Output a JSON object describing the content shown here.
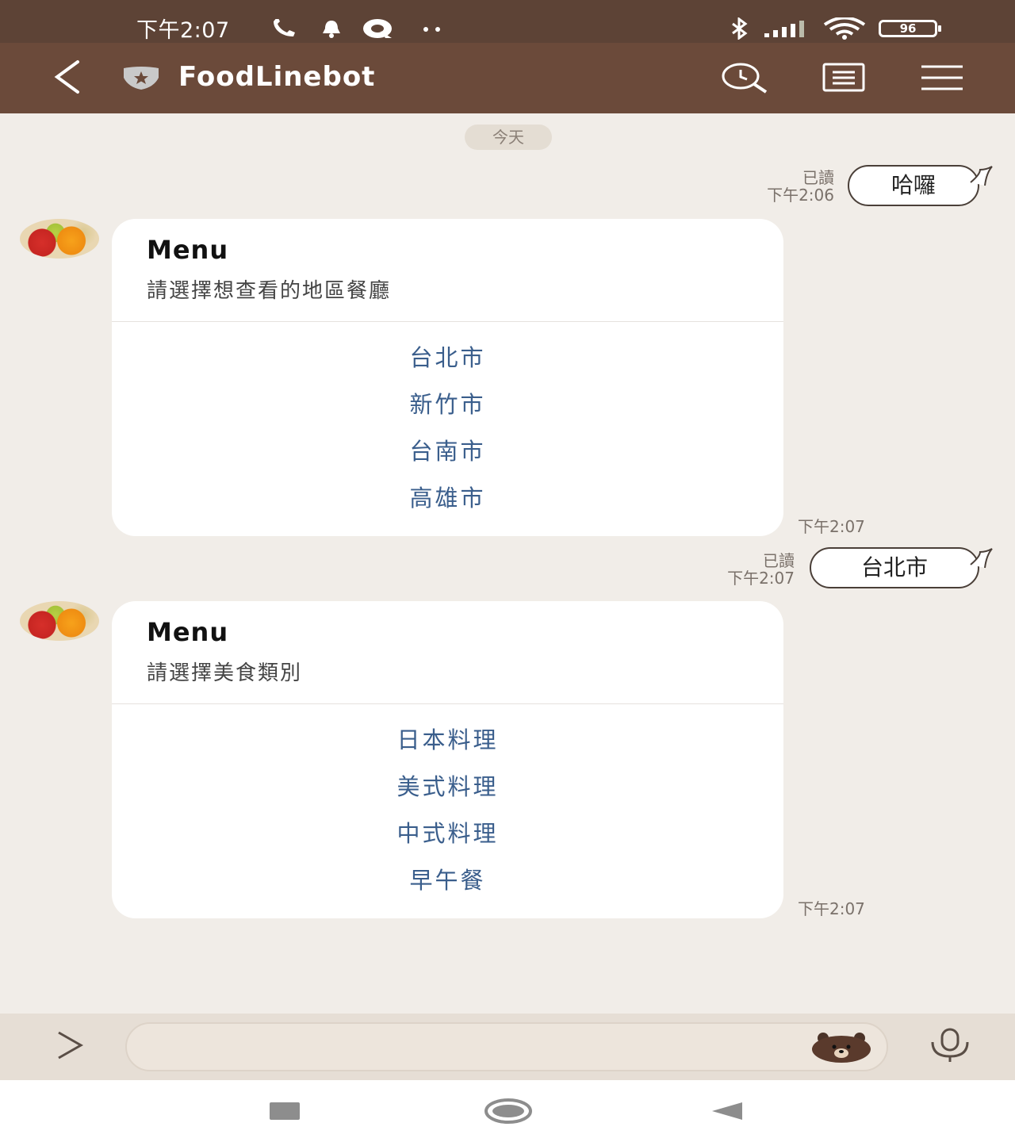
{
  "status_bar": {
    "time": "下午2:07",
    "icons": [
      "phone-icon",
      "bell-icon",
      "q-app-icon",
      "more-dots-icon",
      "bluetooth-icon",
      "signal-icon",
      "wifi-icon",
      "battery-icon"
    ],
    "battery": "96"
  },
  "header": {
    "title": "FoodLinebot",
    "icons": [
      "back-icon",
      "shield-icon",
      "search-history-icon",
      "notes-icon",
      "menu-icon"
    ]
  },
  "date_divider": "今天",
  "messages": [
    {
      "type": "sent",
      "text": "哈囉",
      "read": "已讀",
      "time": "下午2:06"
    },
    {
      "type": "received_card",
      "title": "Menu",
      "subtitle": "請選擇想查看的地區餐廳",
      "options": [
        "台北市",
        "新竹市",
        "台南市",
        "高雄市"
      ],
      "time": "下午2:07"
    },
    {
      "type": "sent",
      "text": "台北市",
      "read": "已讀",
      "time": "下午2:07"
    },
    {
      "type": "received_card",
      "title": "Menu",
      "subtitle": "請選擇美食類別",
      "options": [
        "日本料理",
        "美式料理",
        "中式料理",
        "早午餐"
      ],
      "time": "下午2:07"
    }
  ],
  "input_bar": {
    "placeholder": "",
    "icons": [
      "expand-icon",
      "sticker-bear-icon",
      "microphone-icon"
    ]
  },
  "nav_bar": {
    "icons": [
      "recent-apps-icon",
      "home-icon",
      "back-triangle-icon"
    ]
  },
  "colors": {
    "status_bar": "#5d4336",
    "header": "#6b4a3a",
    "chat_background": "#f1ede8",
    "option_link": "#3a5e8c"
  }
}
